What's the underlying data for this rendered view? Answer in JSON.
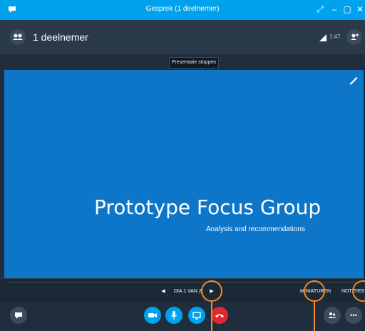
{
  "titlebar": {
    "title": "Gesprek (1 deelnemer)"
  },
  "header": {
    "participants_label": "1 deelnemer",
    "timer": "1:47"
  },
  "stop_presenting_label": "Presentatie stoppen",
  "slide": {
    "title": "Prototype Focus Group",
    "subtitle": "Analysis and recommendations"
  },
  "slide_nav": {
    "counter": "DIA 1 VAN 2",
    "thumbnails_label": "MINIATUREN",
    "notes_label": "NOTITIES"
  },
  "colors": {
    "accent": "#00a2ed",
    "hangup": "#e3262f",
    "callout": "#f08a24",
    "slide_bg": "#0d76c9"
  },
  "icons": [
    "chat-bubble-icon",
    "people-icon",
    "signal-icon",
    "add-person-icon",
    "pencil-icon",
    "video-icon",
    "microphone-icon",
    "share-screen-icon",
    "hangup-icon",
    "participants-icon",
    "more-icon"
  ]
}
